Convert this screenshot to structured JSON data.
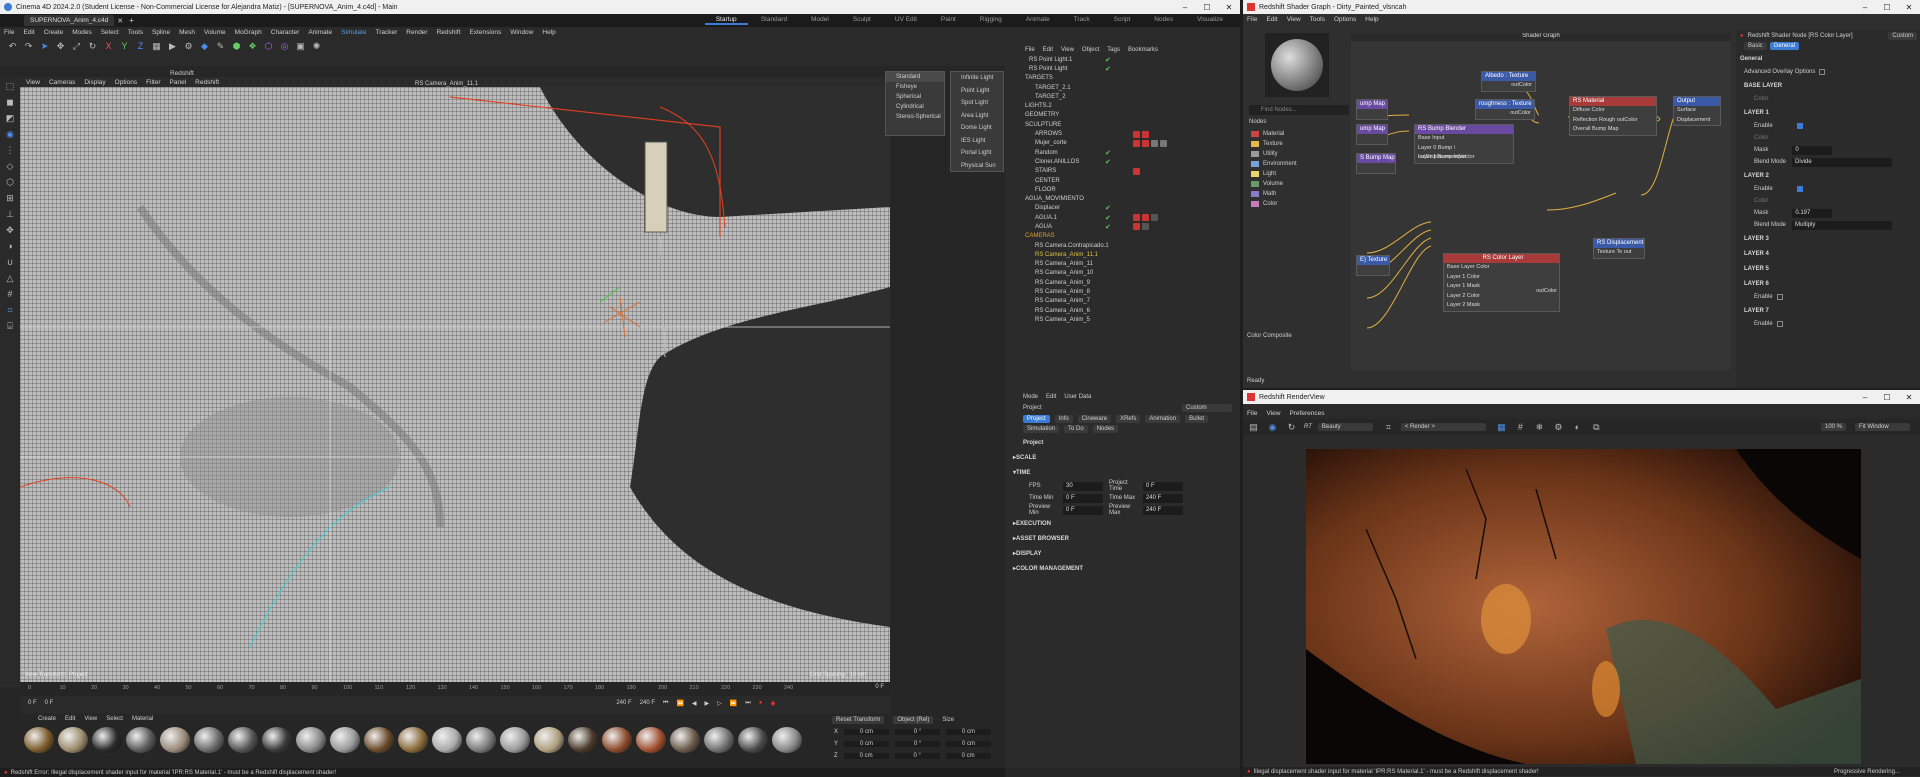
{
  "c4d": {
    "title": "Cinema 4D 2024.2.0 (Student License - Non-Commercial License for Alejandra Matiz) - [SUPERNOVA_Anim_4.c4d] - Main",
    "doc_tab": "SUPERNOVA_Anim_4.c4d",
    "layouts": [
      "Startup",
      "Standard",
      "Model",
      "Sculpt",
      "UV Edit",
      "Paint",
      "Rigging",
      "Animate",
      "Track",
      "Script",
      "Nodes",
      "Visualize"
    ],
    "menu": [
      "File",
      "Edit",
      "Create",
      "Modes",
      "Select",
      "Tools",
      "Spline",
      "Mesh",
      "Volume",
      "MoGraph",
      "Character",
      "Animate",
      "Simulate",
      "Tracker",
      "Render",
      "Redshift",
      "Extensions",
      "Window",
      "Help"
    ],
    "submenu_left": [
      "Redshift"
    ],
    "viewport_menu": [
      "View",
      "Cameras",
      "Display",
      "Options",
      "Filter",
      "Panel",
      "Redshift"
    ],
    "camera_label": "RS Camera_Anim_11.1",
    "view_transform": "View Transform: Project",
    "grid_spacing": "Grid Spacing : 10 cm",
    "ruler": [
      "0",
      "10",
      "20",
      "30",
      "40",
      "50",
      "60",
      "70",
      "80",
      "90",
      "100",
      "110",
      "120",
      "130",
      "140",
      "150",
      "160",
      "170",
      "180",
      "190",
      "200",
      "210",
      "220",
      "230",
      "240"
    ],
    "frame_end": "0 F",
    "time_start": "0 F",
    "time_start2": "0 F",
    "time_end": "240 F",
    "time_end2": "240 F",
    "mat_menu": [
      "Create",
      "Edit",
      "View",
      "Select",
      "Material"
    ],
    "coord": {
      "reset": "Reset Transform",
      "mode": "Object (Rel)",
      "size": "Size",
      "rows": [
        [
          "X",
          "0 cm",
          "0 °",
          "0 cm"
        ],
        [
          "Y",
          "0 cm",
          "0 °",
          "0 cm"
        ],
        [
          "Z",
          "0 cm",
          "0 °",
          "0 cm"
        ]
      ]
    },
    "status": "Redshift Error: Illegal displacement shader input for material 'IPR:RS Material.1' - must be a Redshift displacement shader!",
    "light_menu_left": [
      "Standard",
      "Fisheye",
      "Spherical",
      "Cylindrical",
      "Stereo-Spherical"
    ],
    "light_menu_right": [
      "Infinite Light",
      "Point Light",
      "Spot Light",
      "Area Light",
      "Dome Light",
      "IES Light",
      "Portal Light",
      "Physical Sun"
    ]
  },
  "objects": {
    "menu": [
      "File",
      "Edit",
      "View",
      "Object",
      "Tags",
      "Bookmarks"
    ],
    "rows": [
      "RS Point Light.1",
      "RS Point Light",
      "TARGETS",
      "TARGET_2.1",
      "TARGET_2",
      "LIGHTS.2",
      "GEOMETRY",
      "SCULPTURE",
      "ARROWS",
      "Mujer_corte",
      "Random",
      "Cloner.ANILLOS",
      "STAIRS",
      "CENTER",
      "FLOOR",
      "AGUA_MOVIMIENTO",
      "Displacer",
      "AGUA.1",
      "AGUA",
      "CAMERAS",
      "RS Camera.Contrapicado.1",
      "RS Camera_Anim_11.1",
      "RS Camera_Anim_11",
      "RS Camera_Anim_10",
      "RS Camera_Anim_9",
      "RS Camera_Anim_8",
      "RS Camera_Anim_7",
      "RS Camera_Anim_6",
      "RS Camera_Anim_5"
    ]
  },
  "attributes": {
    "menu": [
      "Mode",
      "Edit",
      "User Data"
    ],
    "title": "Project",
    "preset": "Custom",
    "tabs": [
      "Project",
      "Info",
      "Cineware",
      "XRefs",
      "Animation",
      "Bullet",
      "Simulation",
      "To Do",
      "Nodes"
    ],
    "section": "Project",
    "groups": [
      "SCALE",
      "TIME",
      "EXECUTION",
      "ASSET BROWSER",
      "DISPLAY",
      "COLOR MANAGEMENT"
    ],
    "time": {
      "fps_l": "FPS",
      "fps": "30",
      "pt_l": "Project Time",
      "pt": "0 F",
      "tmin_l": "Time Min",
      "tmin": "0 F",
      "tmax_l": "Time Max",
      "tmax": "240 F",
      "pmin_l": "Preview Min",
      "pmin": "0 F",
      "pmax_l": "Preview Max",
      "pmax": "240 F"
    }
  },
  "shader": {
    "title": "Redshift Shader Graph - Dirty_Painted_vlsncah",
    "menu": [
      "File",
      "Edit",
      "View",
      "Tools",
      "Options",
      "Help"
    ],
    "canvas_title": "Shader Graph",
    "find": "Find Nodes...",
    "nodes_label": "Nodes",
    "categories": [
      "Material",
      "Texture",
      "Utility",
      "Environment",
      "Light",
      "Volume",
      "Math",
      "Color"
    ],
    "cat_colors": [
      "#c44",
      "#e6b84a",
      "#9a9a9a",
      "#7a9ed8",
      "#e8d86a",
      "#6a9a6a",
      "#8a7ac8",
      "#c97ab8"
    ],
    "footer": "Color Composite",
    "ready": "Ready",
    "nodes": {
      "albedo": {
        "t": "Albedo : Texture",
        "p": [
          "outColor"
        ]
      },
      "rough": {
        "t": "roughness : Texture",
        "p": [
          "outColor"
        ]
      },
      "bump": {
        "t": "RS Bump Blender",
        "p": [
          "Base Input",
          "Layer 0 Bump \\ outDisplacementVector",
          "Layer 1 Bump Input"
        ]
      },
      "mat": {
        "t": "RS Material",
        "p": [
          "Diffuse Color",
          "Reflection Rough outColor",
          "Overall Bump Map"
        ]
      },
      "out": {
        "t": "Output",
        "p": [
          "Surface",
          "Displacement"
        ]
      },
      "layer": {
        "t": "RS Color Layer",
        "p": [
          "Base Layer Color",
          "Layer 1 Color",
          "Layer 1 Mask",
          "Layer 2 Color",
          "Layer 2 Mask"
        ],
        "out": "outColor"
      },
      "disp": {
        "t": "RS Displacement",
        "p": [
          "Texture Te  out"
        ]
      },
      "map1": "ump Map",
      "map2": "ump Map",
      "map3": "S Bump Map",
      "tex": "E) Texture"
    }
  },
  "props": {
    "title": "Redshift Shader Node [RS Color Layer]",
    "preset": "Custom",
    "tabs": [
      "Basic",
      "General"
    ],
    "general": "General",
    "adv": "Advanced Overlay Options",
    "base": "BASE LAYER",
    "color": "Color",
    "layers": [
      {
        "n": "LAYER 1",
        "enable": "Enable",
        "color": "Color",
        "mask": "Mask",
        "maskv": "0",
        "blend": "Blend Mode",
        "blendv": "Divide"
      },
      {
        "n": "LAYER 2",
        "enable": "Enable",
        "color": "Color",
        "mask": "Mask",
        "maskv": "0.197",
        "blend": "Blend Mode",
        "blendv": "Multiply"
      }
    ],
    "more": [
      "LAYER 3",
      "LAYER 4",
      "LAYER 5",
      "LAYER 6",
      "LAYER 7"
    ],
    "enable": "Enable"
  },
  "render": {
    "title": "Redshift RenderView",
    "menu": [
      "File",
      "View",
      "Preferences"
    ],
    "aov": "Beauty",
    "rtype": "< Render >",
    "zoom": "100 %",
    "fit": "Fit Window",
    "status": "Illegal displacement shader input for material 'IPR:RS Material.1' - must be a Redshift displacement shader!",
    "progress": "Progressive Rendering..."
  }
}
